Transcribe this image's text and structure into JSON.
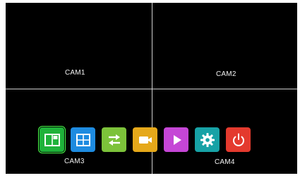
{
  "cameras": [
    {
      "label": "CAM1"
    },
    {
      "label": "CAM2"
    },
    {
      "label": "CAM3"
    },
    {
      "label": "CAM4"
    }
  ],
  "toolbar": {
    "buttons": [
      {
        "icon": "single-view-icon",
        "color": "#1fb23a",
        "active": true
      },
      {
        "icon": "quad-view-icon",
        "color": "#1e8be0"
      },
      {
        "icon": "switch-arrows-icon",
        "color": "#7cc23a"
      },
      {
        "icon": "video-camera-icon",
        "color": "#e5a81a"
      },
      {
        "icon": "play-icon",
        "color": "#c546d6"
      },
      {
        "icon": "gear-icon",
        "color": "#17a2a6"
      },
      {
        "icon": "power-icon",
        "color": "#e43a2e"
      }
    ]
  }
}
